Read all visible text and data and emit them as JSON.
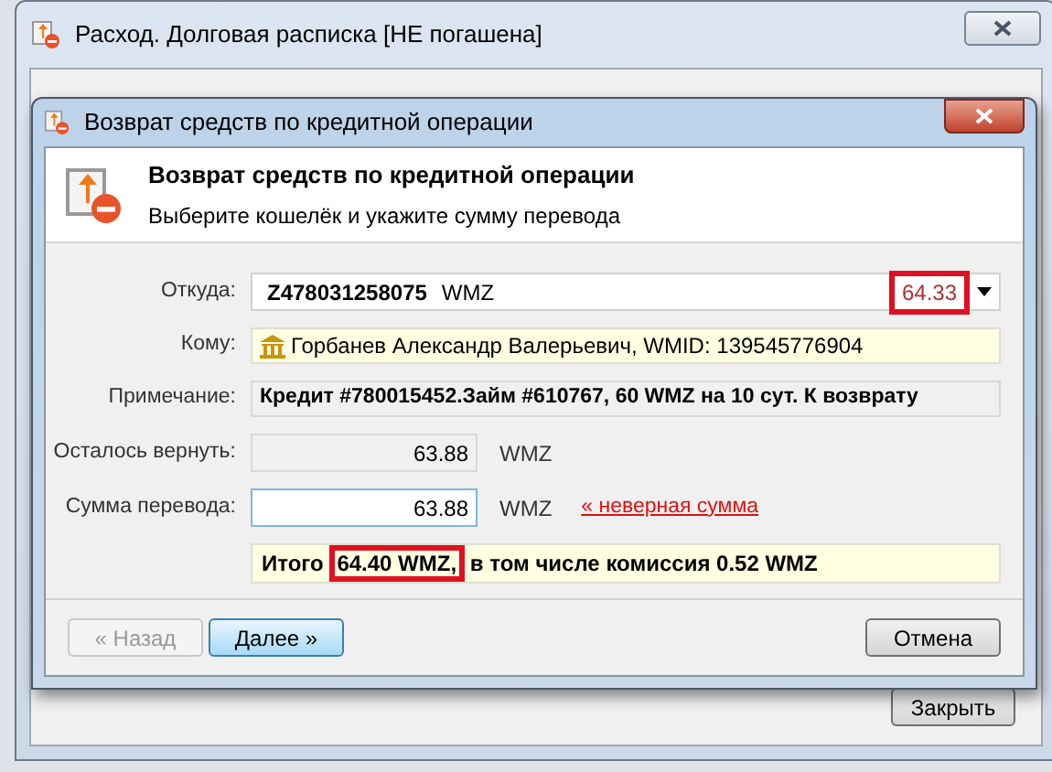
{
  "background_window": {
    "title": "Расход. Долговая расписка [НЕ погашена]",
    "close_button": "Закрыть"
  },
  "dialog": {
    "title": "Возврат средств по кредитной операции",
    "header": {
      "title": "Возврат средств по кредитной операции",
      "subtitle": "Выберите кошелёк и укажите сумму перевода"
    },
    "fields": [
      {
        "kind": "combo",
        "label": "Откуда:",
        "wallet": "Z478031258075",
        "currency": "WMZ",
        "balance": "64.33",
        "highlighted": true
      },
      {
        "kind": "recipient",
        "label": "Кому:",
        "value": "Горбанев Александр Валерьевич, WMID: 139545776904"
      },
      {
        "kind": "note",
        "label": "Примечание:",
        "value": "Кредит #780015452.Займ #610767, 60 WMZ на 10 сут. К возврату"
      },
      {
        "kind": "amount",
        "label": "Осталось вернуть:",
        "value": "63.88",
        "currency": "WMZ",
        "editable": false
      },
      {
        "kind": "amount",
        "label": "Сумма перевода:",
        "value": "63.88",
        "currency": "WMZ",
        "editable": true,
        "error": "« неверная сумма"
      }
    ],
    "total": {
      "prefix": "Итого",
      "amount": "64.40 WMZ,",
      "rest": "в том числе комиссия 0.52 WMZ",
      "highlighted": true
    },
    "buttons": [
      {
        "label": "« Назад",
        "disabled": true,
        "default": false
      },
      {
        "label": "Далее »",
        "disabled": false,
        "default": true
      },
      {
        "label": "Отмена",
        "disabled": false,
        "default": false
      }
    ]
  }
}
